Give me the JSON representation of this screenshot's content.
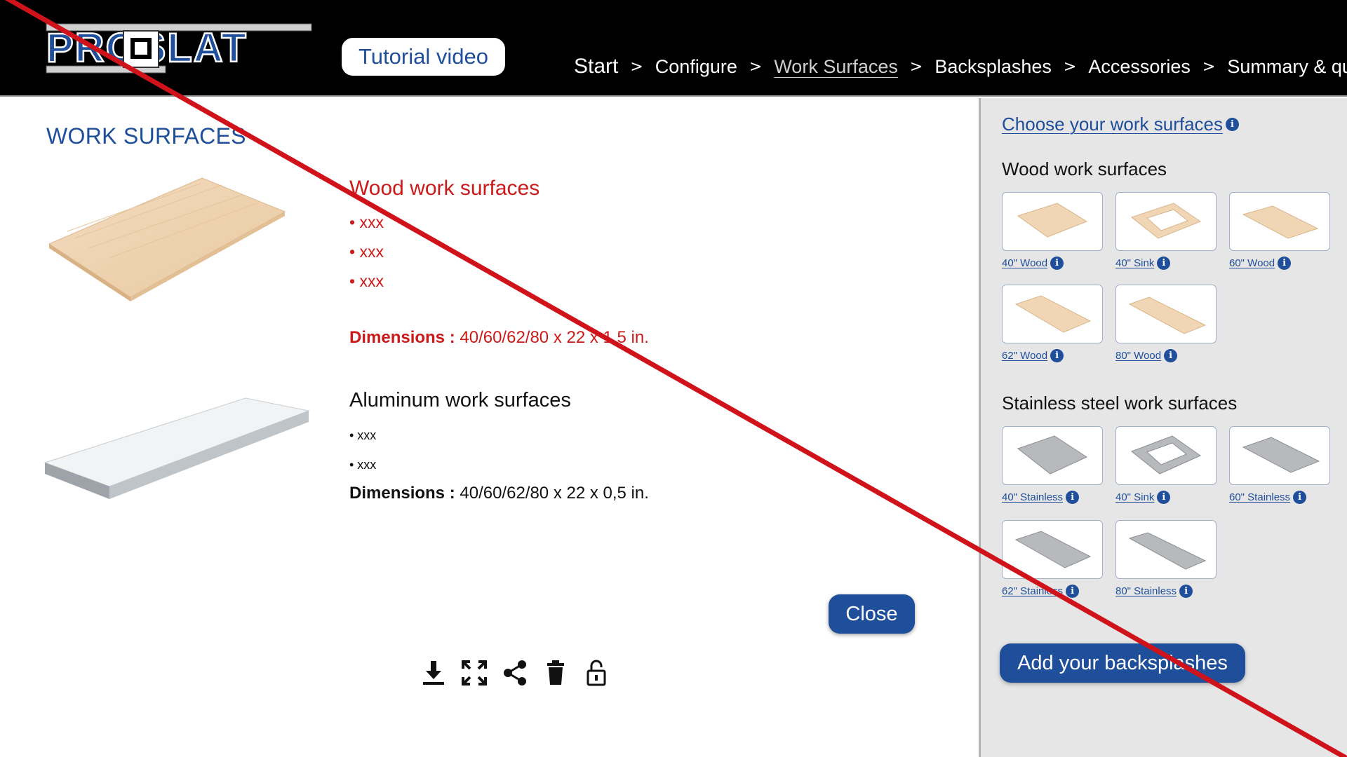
{
  "header": {
    "logo_text": "PROSLAT",
    "tutorial_label": "Tutorial video",
    "breadcrumb": [
      {
        "label": "Start"
      },
      {
        "label": "Configure"
      },
      {
        "label": "Work Surfaces"
      },
      {
        "label": "Backsplashes"
      },
      {
        "label": "Accessories"
      },
      {
        "label": "Summary & quote"
      }
    ],
    "separator": ">"
  },
  "main": {
    "title": "WORK SURFACES",
    "wood": {
      "title": "Wood work surfaces",
      "bullets": [
        "• xxx",
        "• xxx",
        "• xxx"
      ],
      "dims_label": "Dimensions :",
      "dims_value": " 40/60/62/80 x  22 x 1,5 in."
    },
    "aluminum": {
      "title": "Aluminum work surfaces",
      "bullets": [
        "• xxx",
        "• xxx"
      ],
      "dims_label": "Dimensions :",
      "dims_value": " 40/60/62/80 x 22 x 0,5 in."
    },
    "close_label": "Close"
  },
  "sidebar": {
    "heading": "Choose your work surfaces",
    "wood_section": "Wood work surfaces",
    "wood_items": [
      {
        "label": "40\" Wood"
      },
      {
        "label": "40\" Sink"
      },
      {
        "label": "60\" Wood"
      },
      {
        "label": "62\" Wood"
      },
      {
        "label": "80\" Wood"
      }
    ],
    "steel_section": "Stainless steel work surfaces",
    "steel_items": [
      {
        "label": "40\" Stainless"
      },
      {
        "label": "40\" Sink"
      },
      {
        "label": "60\" Stainless"
      },
      {
        "label": "62\" Stainless"
      },
      {
        "label": "80\" Stainless"
      }
    ],
    "add_label": "Add your backsplashes"
  },
  "icons": {
    "info": "info-icon",
    "tools": [
      "download-icon",
      "fullscreen-icon",
      "share-icon",
      "trash-icon",
      "lock-open-icon"
    ]
  },
  "colors": {
    "brand_blue": "#1f4e9a",
    "accent_red": "#cc1a1a",
    "header_bg": "#000000",
    "sidebar_bg": "#e6e6e6"
  }
}
